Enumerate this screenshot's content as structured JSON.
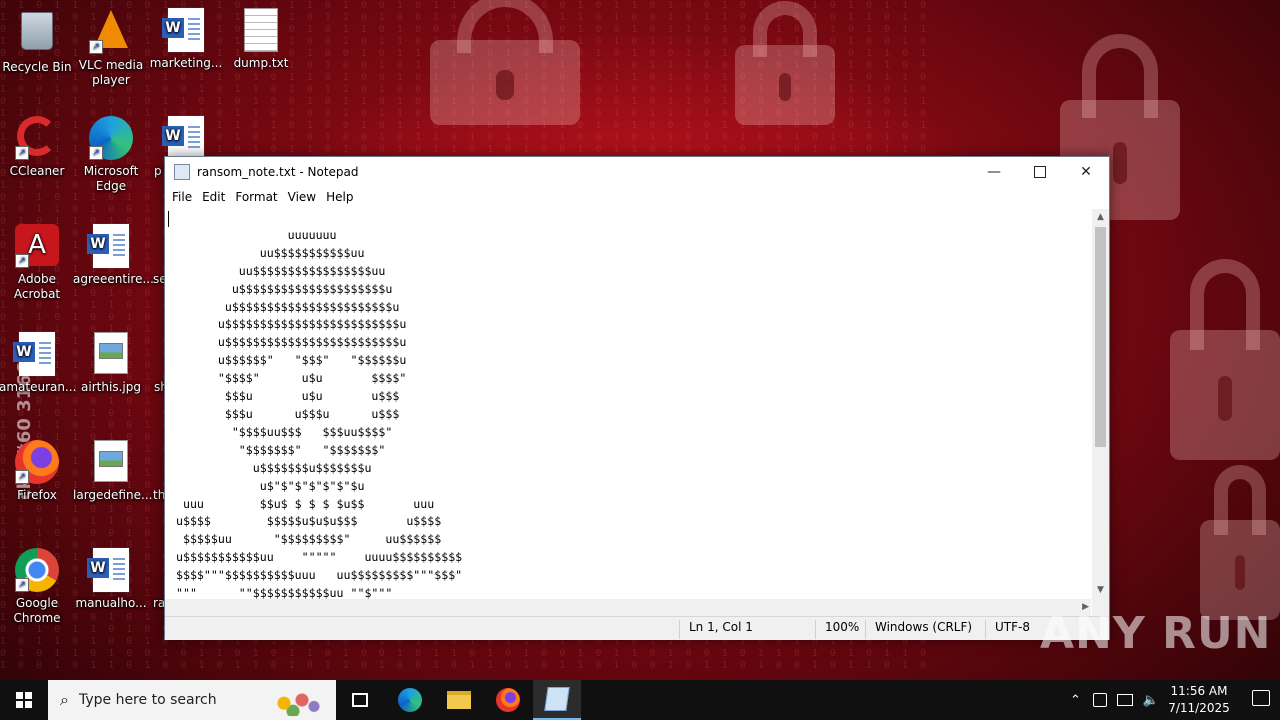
{
  "desktop": {
    "icons": [
      {
        "label": "Recycle Bin"
      },
      {
        "label": "VLC media player"
      },
      {
        "label": "marketing..."
      },
      {
        "label": "dump.txt"
      },
      {
        "label": "CCleaner"
      },
      {
        "label": "Microsoft Edge"
      },
      {
        "label": "p"
      },
      {
        "label": "Adobe Acrobat"
      },
      {
        "label": "agreeentire..."
      },
      {
        "label": "se"
      },
      {
        "label": "amateuran..."
      },
      {
        "label": "airthis.jpg"
      },
      {
        "label": "sh"
      },
      {
        "label": "Firefox"
      },
      {
        "label": "largedefine..."
      },
      {
        "label": "th"
      },
      {
        "label": "Google Chrome"
      },
      {
        "label": "manualho..."
      },
      {
        "label": "ra"
      }
    ],
    "watermark_left": "ck | #60 3166",
    "watermark_brand": "ANY RUN"
  },
  "notepad": {
    "title": "ransom_note.txt - Notepad",
    "menu": [
      "File",
      "Edit",
      "Format",
      "View",
      "Help"
    ],
    "content": "\n                 uuuuuuu\n             uu$$$$$$$$$$$uu\n          uu$$$$$$$$$$$$$$$$$uu\n         u$$$$$$$$$$$$$$$$$$$$$u\n        u$$$$$$$$$$$$$$$$$$$$$$$u\n       u$$$$$$$$$$$$$$$$$$$$$$$$$u\n       u$$$$$$$$$$$$$$$$$$$$$$$$$u\n       u$$$$$$\"   \"$$$\"   \"$$$$$$u\n       \"$$$$\"      u$u       $$$$\"\n        $$$u       u$u       u$$$\n        $$$u      u$$$u      u$$$\n         \"$$$$uu$$$   $$$uu$$$$\"\n          \"$$$$$$$\"   \"$$$$$$$\"\n            u$$$$$$$u$$$$$$$u\n             u$\"$\"$\"$\"$\"$\"$u\n  uuu        $$u$ $ $ $ $u$$       uuu\n u$$$$        $$$$$u$u$u$$$       u$$$$\n  $$$$$uu      \"$$$$$$$$$\"     uu$$$$$$\n u$$$$$$$$$$$uu    \"\"\"\"\"    uuuu$$$$$$$$$$\n $$$$\"\"\"$$$$$$$$$$uuu   uu$$$$$$$$$\"\"\"$$$\"\n \"\"\"      \"\"$$$$$$$$$$$uu \"\"$\"\"\"",
    "status": {
      "position": "Ln 1, Col 1",
      "zoom": "100%",
      "line_ending": "Windows (CRLF)",
      "encoding": "UTF-8"
    }
  },
  "taskbar": {
    "search_placeholder": "Type here to search",
    "time": "11:56 AM",
    "date": "7/11/2025"
  }
}
